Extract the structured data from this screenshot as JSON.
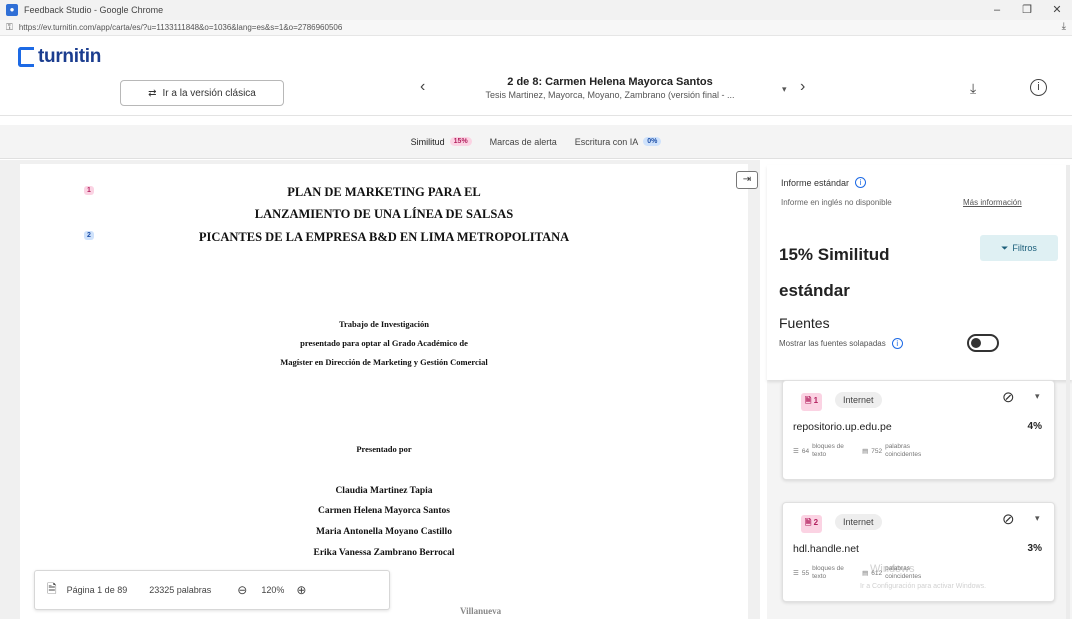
{
  "window": {
    "title": "Feedback Studio - Google Chrome",
    "url": "https://ev.turnitin.com/app/carta/es/?u=1133111848&o=1036&lang=es&s=1&o=2786960506",
    "controls": [
      "–",
      "❐",
      "✕"
    ]
  },
  "header": {
    "logo": "turnitin",
    "classic_button": "Ir a la versión clásica",
    "doc_title": "2 de 8: Carmen Helena Mayorca Santos",
    "doc_subtitle": "Tesis Martinez, Mayorca, Moyano, Zambrano (versión final - ...",
    "prev": "‹",
    "next": "›"
  },
  "tabs": [
    {
      "label": "Similitud",
      "badge": "15%"
    },
    {
      "label": "Marcas de alerta",
      "badge": ""
    },
    {
      "label": "Escritura con IA",
      "badge": "0%"
    }
  ],
  "document": {
    "markers": [
      "1",
      "2"
    ],
    "title_lines": [
      "PLAN DE MARKETING PARA EL",
      "LANZAMIENTO DE UNA LÍNEA DE SALSAS",
      "PICANTES DE LA EMPRESA B&D EN LIMA METROPOLITANA"
    ],
    "purpose_lines": [
      "Trabajo de Investigación",
      "presentado para optar al Grado Académico de",
      "Magíster en Dirección de Marketing y Gestión Comercial"
    ],
    "presented_by": "Presentado por",
    "authors": [
      "Claudia Martinez Tapia",
      "Carmen Helena Mayorca Santos",
      "Maria Antonella Moyano Castillo",
      "Erika Vanessa Zambrano Berrocal"
    ],
    "peek": "Villanueva"
  },
  "page_toolbar": {
    "page": "Página 1 de 89",
    "words": "23325 palabras",
    "zoom": "120%"
  },
  "side_panel": {
    "report_label": "Informe estándar",
    "english_note": "Informe en inglés no disponible",
    "more_info": "Más información",
    "similarity_title": "15% Similitud estándar",
    "filters": "Filtros",
    "sources_heading": "Fuentes",
    "overlap_label": "Mostrar las fuentes solapadas",
    "sources": [
      {
        "num": "1",
        "type": "Internet",
        "name": "repositorio.up.edu.pe",
        "pct": "4%",
        "blocks": "64",
        "blocks_label": "bloques de texto",
        "words": "752",
        "words_label": "palabras coincidentes"
      },
      {
        "num": "2",
        "type": "Internet",
        "name": "hdl.handle.net",
        "pct": "3%",
        "blocks": "55",
        "blocks_label": "bloques de texto",
        "words": "612",
        "words_label": "palabras coincidentes"
      }
    ]
  },
  "watermark": {
    "line1": "Windows",
    "line2": "Ir a Configuración para activar Windows."
  }
}
